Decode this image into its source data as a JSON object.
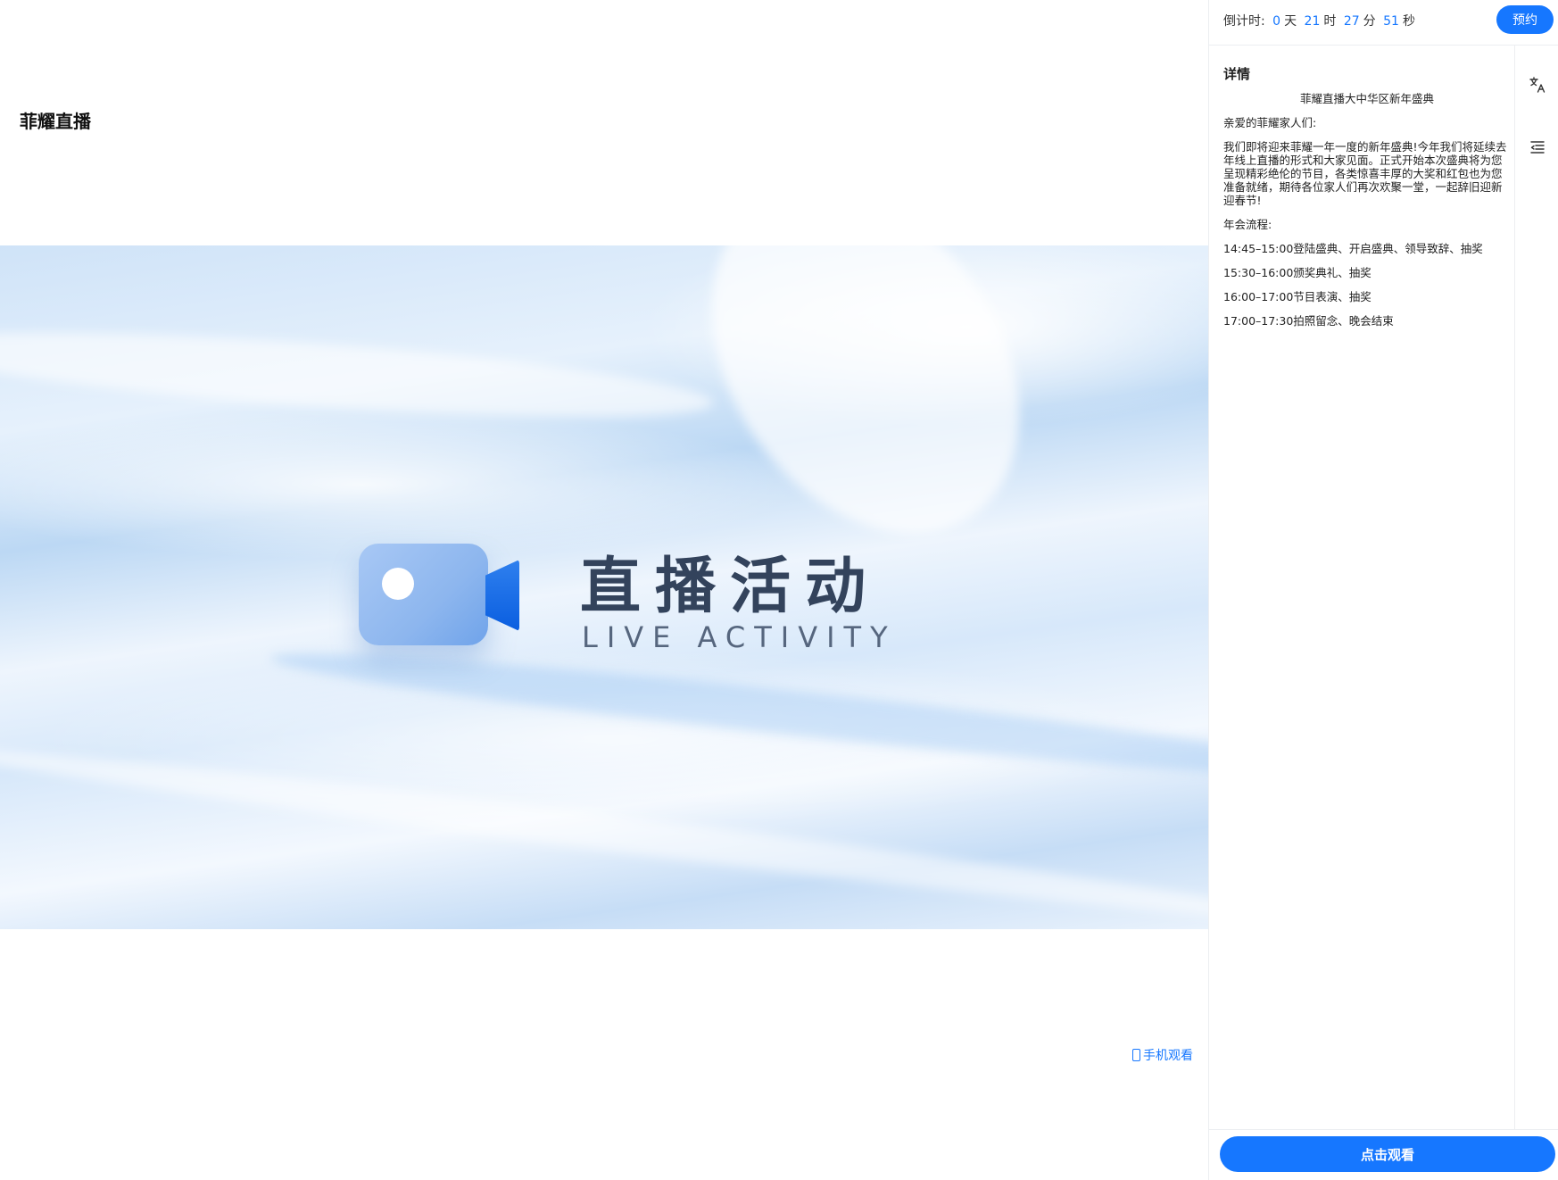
{
  "page": {
    "title": "菲耀直播"
  },
  "banner": {
    "title": "直播活动",
    "subtitle": "LIVE ACTIVITY"
  },
  "mobile_watch": {
    "label": "手机观看"
  },
  "countdown": {
    "label": "倒计时:",
    "days": "0",
    "days_unit": "天",
    "hours": "21",
    "hours_unit": "时",
    "minutes": "27",
    "minutes_unit": "分",
    "seconds": "51",
    "seconds_unit": "秒"
  },
  "book_button": {
    "label": "预约"
  },
  "details": {
    "heading": "详情",
    "event_title": "菲耀直播大中华区新年盛典",
    "greeting": "亲爱的菲耀家人们:",
    "body": "我们即将迎来菲耀一年一度的新年盛典!今年我们将延续去年线上直播的形式和大家见面。正式开始本次盛典将为您呈现精彩绝伦的节目，各类惊喜丰厚的大奖和红包也为您准备就绪，期待各位家人们再次欢聚一堂，一起辞旧迎新迎春节!",
    "schedule_label": "年会流程:",
    "schedule": [
      "14:45–15:00登陆盛典、开启盛典、领导致辞、抽奖",
      "15:30–16:00颁奖典礼、抽奖",
      "16:00–17:00节目表演、抽奖",
      "17:00–17:30拍照留念、晚会结束"
    ]
  },
  "watch_button": {
    "label": "点击观看"
  },
  "colors": {
    "accent": "#1677ff",
    "title_text": "#33435c"
  },
  "icons": {
    "translate": "translate-icon",
    "outline": "outline-icon",
    "phone": "phone-icon",
    "camera": "video-camera-icon"
  }
}
